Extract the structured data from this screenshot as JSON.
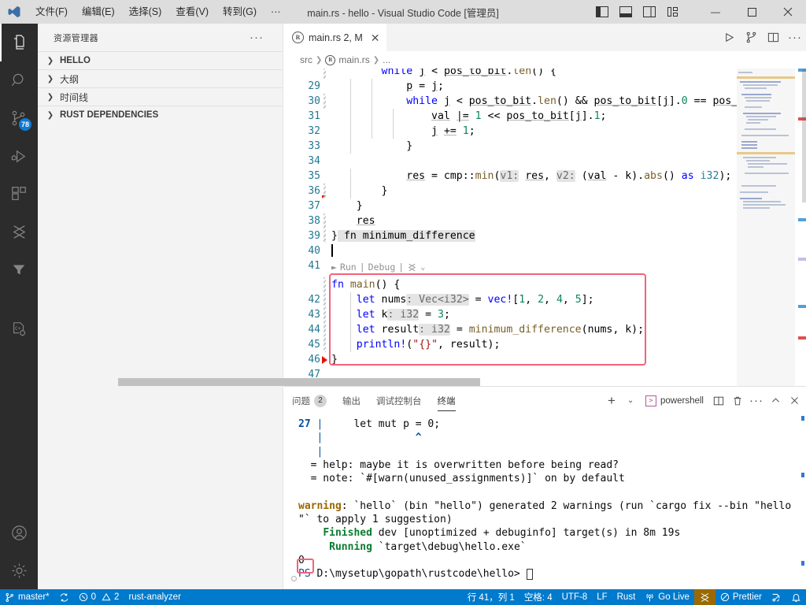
{
  "titlebar": {
    "logo": "vscode-logo",
    "menus": [
      "文件(F)",
      "编辑(E)",
      "选择(S)",
      "查看(V)",
      "转到(G)",
      "···"
    ],
    "title": "main.rs - hello - Visual Studio Code [管理员]",
    "layout_icons": [
      "toggle-primary-sidebar",
      "toggle-panel",
      "toggle-secondary-sidebar",
      "customize-layout"
    ],
    "window_controls": {
      "minimize": "—",
      "maximize": "▢",
      "close": "✕"
    }
  },
  "activitybar": {
    "items": [
      {
        "name": "explorer",
        "icon": "files-icon",
        "active": true,
        "badge": ""
      },
      {
        "name": "search",
        "icon": "search-icon",
        "active": false,
        "badge": ""
      },
      {
        "name": "source-control",
        "icon": "source-control-icon",
        "active": false,
        "badge": "78"
      },
      {
        "name": "run-and-debug",
        "icon": "debug-icon",
        "active": false,
        "badge": ""
      },
      {
        "name": "extensions",
        "icon": "extensions-icon",
        "active": false,
        "badge": ""
      },
      {
        "name": "prettier",
        "icon": "prettier-icon",
        "active": false,
        "badge": ""
      },
      {
        "name": "filter",
        "icon": "funnel-icon",
        "active": false,
        "badge": ""
      },
      {
        "name": "cpp-config",
        "icon": "cpp-gear-icon",
        "active": false,
        "badge": ""
      }
    ],
    "bottom": [
      {
        "name": "accounts",
        "icon": "account-icon"
      },
      {
        "name": "settings",
        "icon": "gear-icon"
      }
    ]
  },
  "sidebar": {
    "header": "资源管理器",
    "more": "···",
    "sections": [
      {
        "label": "HELLO",
        "expanded": false,
        "cjk": false
      },
      {
        "label": "大纲",
        "expanded": false,
        "cjk": true
      },
      {
        "label": "时间线",
        "expanded": false,
        "cjk": true
      },
      {
        "label": "RUST DEPENDENCIES",
        "expanded": false,
        "cjk": false
      }
    ]
  },
  "editor": {
    "tab": {
      "icon": "rust-icon",
      "label": "main.rs 2, M",
      "close": "✕"
    },
    "tab_actions": [
      "run-icon",
      "split-merge-icon",
      "split-editor-icon",
      "more-actions-icon"
    ],
    "breadcrumb": [
      "src",
      "main.rs",
      "..."
    ],
    "codelens": {
      "run": "Run",
      "sep1": "|",
      "debug": "Debug",
      "sep2": "|",
      "extra": "prettier-glyph"
    },
    "cursor_line": 41,
    "lines": [
      {
        "n": 29,
        "indent": 8,
        "text": "while j < pos_to_bit.len() {"
      },
      {
        "n": 30,
        "indent": 12,
        "text": "p = j;"
      },
      {
        "n": 31,
        "indent": 12,
        "text": "while j < pos_to_bit.len() && pos_to_bit[j].0 == pos_t"
      },
      {
        "n": 32,
        "indent": 16,
        "text": "val |= 1 << pos_to_bit[j].1;"
      },
      {
        "n": 33,
        "indent": 16,
        "text": "j += 1;"
      },
      {
        "n": 34,
        "indent": 12,
        "text": "}"
      },
      {
        "n": 35,
        "indent": 0,
        "text": ""
      },
      {
        "n": 36,
        "indent": 12,
        "text": "res = cmp::min(v1: res, v2: (val - k).abs() as i32);"
      },
      {
        "n": 37,
        "indent": 8,
        "text": "}"
      },
      {
        "n": 38,
        "indent": 4,
        "text": "}"
      },
      {
        "n": 39,
        "indent": 4,
        "text": "res"
      },
      {
        "n": 40,
        "indent": 0,
        "text": "} fn minimum_difference"
      },
      {
        "n": 41,
        "indent": 0,
        "text": ""
      },
      {
        "n": 42,
        "indent": 0,
        "text": "fn main() {"
      },
      {
        "n": 43,
        "indent": 4,
        "text": "let nums: Vec<i32> = vec![1, 2, 4, 5];"
      },
      {
        "n": 44,
        "indent": 4,
        "text": "let k: i32 = 3;"
      },
      {
        "n": 45,
        "indent": 4,
        "text": "let result: i32 = minimum_difference(nums, k);"
      },
      {
        "n": 46,
        "indent": 4,
        "text": "println!(\"{}\", result);"
      },
      {
        "n": 47,
        "indent": 0,
        "text": "}"
      }
    ],
    "highlight_box_color": "#f2637b"
  },
  "panel": {
    "tabs": [
      {
        "label": "问题",
        "badge": "2",
        "active": false
      },
      {
        "label": "输出",
        "badge": "",
        "active": false
      },
      {
        "label": "调试控制台",
        "badge": "",
        "active": false
      },
      {
        "label": "终端",
        "badge": "",
        "active": true
      }
    ],
    "actions": {
      "new_terminal": "+",
      "new_terminal_dropdown": "⌄",
      "shell_label": "powershell",
      "split": "split-terminal-icon",
      "kill": "trash-icon",
      "more": "···",
      "maximize": "chevron-up-icon",
      "close": "✕"
    },
    "terminal_lines": [
      {
        "type": "diag",
        "num": "27",
        "bar": "|",
        "text": "    let mut p = 0;"
      },
      {
        "type": "caret",
        "bar": "|",
        "text": "              ^"
      },
      {
        "type": "bar",
        "bar": "|",
        "text": ""
      },
      {
        "type": "plain",
        "text": "  = help: maybe it is overwritten before being read?"
      },
      {
        "type": "plain",
        "text": "  = note: `#[warn(unused_assignments)]` on by default"
      },
      {
        "type": "blank",
        "text": ""
      },
      {
        "type": "warn",
        "text": "warning: `hello` (bin \"hello\") generated 2 warnings (run `cargo fix --bin \"hello"
      },
      {
        "type": "plain",
        "text": "\"` to apply 1 suggestion)"
      },
      {
        "type": "finished",
        "label": "Finished",
        "text": " dev [unoptimized + debuginfo] target(s) in 8m 19s"
      },
      {
        "type": "running",
        "label": "Running",
        "text": " `target\\debug\\hello.exe`"
      },
      {
        "type": "output",
        "text": "0"
      },
      {
        "type": "prompt",
        "text": "PS D:\\mysetup\\gopath\\rustcode\\hello> "
      }
    ]
  },
  "statusbar": {
    "left": [
      {
        "icon": "source-control-icon",
        "label": "master*"
      },
      {
        "icon": "sync-icon",
        "label": ""
      },
      {
        "icon": "error-warning-icon",
        "label": "0  2"
      },
      {
        "icon": "",
        "label": "rust-analyzer"
      }
    ],
    "right": [
      {
        "icon": "",
        "label": "行 41，列 1"
      },
      {
        "icon": "",
        "label": "空格: 4"
      },
      {
        "icon": "",
        "label": "UTF-8"
      },
      {
        "icon": "",
        "label": "LF"
      },
      {
        "icon": "",
        "label": "Rust"
      },
      {
        "icon": "broadcast-icon",
        "label": "Go Live"
      },
      {
        "icon": "prettier-glyph-icon",
        "label": "",
        "highlight": true
      },
      {
        "icon": "prettier-check-icon",
        "label": "Prettier"
      },
      {
        "icon": "remote-icon",
        "label": ""
      },
      {
        "icon": "bell-icon",
        "label": ""
      }
    ]
  },
  "colors": {
    "accent": "#007acc",
    "titlebar_bg": "#dddddd",
    "activitybar_bg": "#2c2c2c",
    "sidebar_bg": "#f3f3f3",
    "editor_bg": "#ffffff",
    "badge_bg": "#0e7ad4",
    "highlight_red": "#f2637b"
  }
}
